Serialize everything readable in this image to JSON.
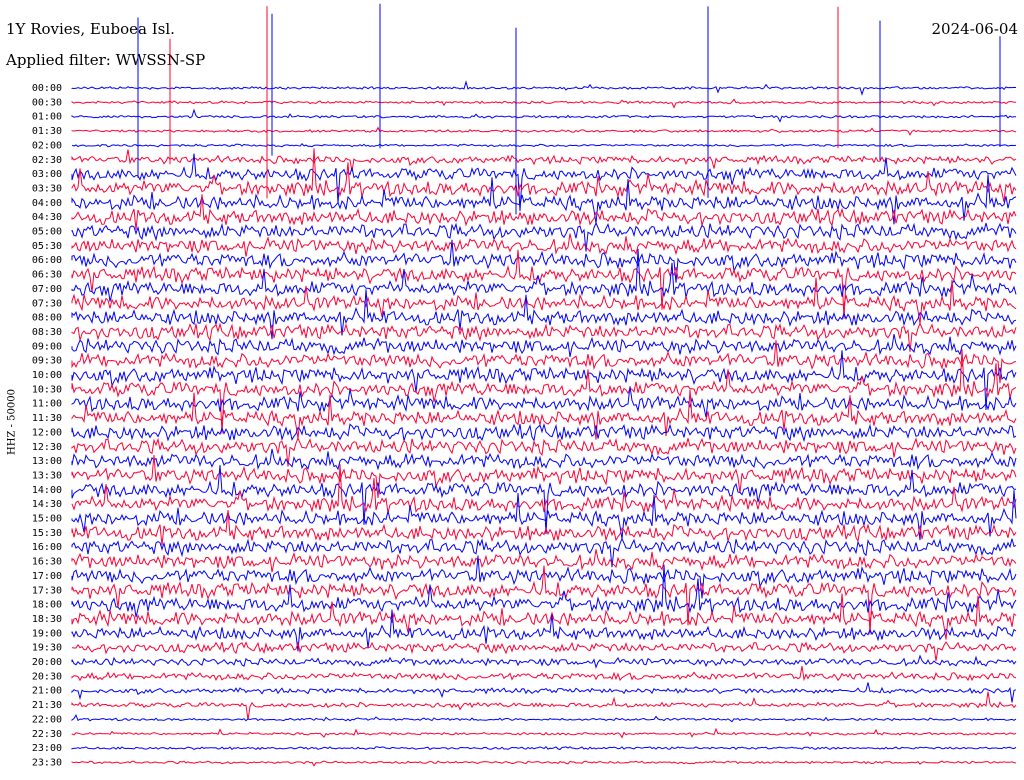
{
  "chart_data": {
    "type": "line",
    "title": "1Y Rovies, Euboea Isl.",
    "subtitle": "Applied filter: WWSSN-SP",
    "date": "2024-06-04",
    "ylabel": "HHZ - 50000",
    "colors": [
      "#0000ff",
      "#ff0033"
    ],
    "row_labels": [
      "00:00",
      "00:30",
      "01:00",
      "01:30",
      "02:00",
      "02:30",
      "03:00",
      "03:30",
      "04:00",
      "04:30",
      "05:00",
      "05:30",
      "06:00",
      "06:30",
      "07:00",
      "07:30",
      "08:00",
      "08:30",
      "09:00",
      "09:30",
      "10:00",
      "10:30",
      "11:00",
      "11:30",
      "12:00",
      "12:30",
      "13:00",
      "13:30",
      "14:00",
      "14:30",
      "15:00",
      "15:30",
      "16:00",
      "16:30",
      "17:00",
      "17:30",
      "18:00",
      "18:30",
      "19:00",
      "19:30",
      "20:00",
      "20:30",
      "21:00",
      "21:30",
      "22:00",
      "22:30",
      "23:00",
      "23:30"
    ],
    "activity": [
      1,
      1,
      1,
      1,
      1,
      3,
      5,
      6,
      6,
      6,
      6,
      6,
      6,
      6,
      6,
      6,
      6,
      6,
      6,
      6,
      6,
      6,
      6,
      6,
      6,
      6,
      6,
      6,
      6,
      6,
      6,
      6,
      6,
      6,
      6,
      6,
      6,
      6,
      5,
      4,
      3,
      3,
      2,
      2,
      1,
      1,
      1,
      1
    ]
  }
}
